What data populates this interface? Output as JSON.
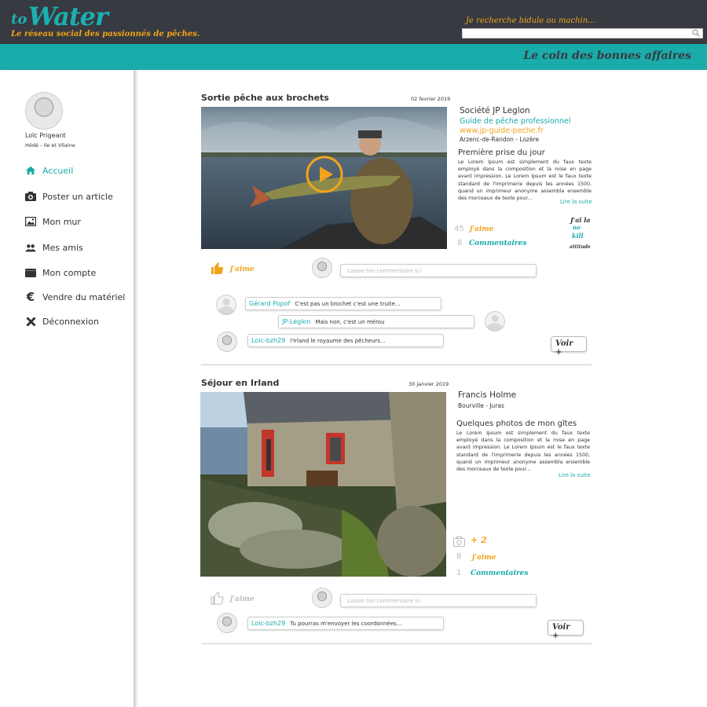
{
  "header": {
    "logo_prefix": "to",
    "logo_main": "Water",
    "tagline": "Le réseau social des passionnés de pêches.",
    "search_placeholder": "Je recherche bidule ou machin...",
    "deals_link": "Le coin des bonnes affaires"
  },
  "user": {
    "name": "Loïc Prigeant",
    "location": "Hédé - Ile et Vilaine"
  },
  "nav": [
    {
      "label": "Accueil",
      "icon": "home-icon"
    },
    {
      "label": "Poster un article",
      "icon": "camera-icon"
    },
    {
      "label": "Mon mur",
      "icon": "image-icon"
    },
    {
      "label": "Mes amis",
      "icon": "friends-icon"
    },
    {
      "label": "Mon compte",
      "icon": "wallet-icon"
    },
    {
      "label": "Vendre du matériel",
      "icon": "euro-icon"
    },
    {
      "label": "Déconnexion",
      "icon": "close-icon"
    }
  ],
  "posts": [
    {
      "title": "Sortie pêche aux brochets",
      "date": "02 fevrier 2019",
      "author": "Société JP Leglon",
      "subtitle": "Guide de pêche professionnel",
      "website": "www.jp-guide-peche.fr",
      "location": "Arzenc-de-Randon - Lozère",
      "headline": "Première prise du jour",
      "excerpt": "Le Lorem Ipsum est simplement du faux texte employé dans la composition et la mise en page avant impression. Le Lorem Ipsum est le faux texte standard de l'imprimerie depuis les années 1500, quand un imprimeur anonyme assembla ensemble des morceaux de texte pour...",
      "read_more": "Lire la suite",
      "likes": "45",
      "likes_label": "j'aime",
      "comments_count": "8",
      "comments_label": "Commentaires",
      "badge": [
        "J'ai la",
        "no",
        "kill",
        "attitude"
      ],
      "like_label": "j'aime",
      "comment_placeholder": "Laisse ton commentaire ici",
      "comments": [
        {
          "author": "Gérard Popof",
          "text": "C'est pas un brochet c'est une truite..."
        },
        {
          "author": "JP-Leglon",
          "text": "Mais non, c'est un mérou"
        },
        {
          "author": "Loic-bzh29",
          "text": "l'Irland le royaume des pêcheurs..."
        }
      ],
      "more_label": "Voir +"
    },
    {
      "title": "Séjour en Irland",
      "date": "30 janvier 2019",
      "author": "Francis Holme",
      "location": "Bourville - Juras",
      "headline": "Quelques photos de mon gîtes",
      "excerpt": "Le Lorem Ipsum est simplement du faux texte employé dans la composition et la mise en page avant impression. Le Lorem Ipsum est le faux texte standard de l'imprimerie depuis les années 1500, quand un imprimeur anonyme assembla ensemble des morceaux de texte pour...",
      "read_more": "Lire la suite",
      "photos_extra": "+ 2",
      "likes": "8",
      "likes_label": "j'aime",
      "comments_count": "1",
      "comments_label": "Commentaires",
      "like_label": "j'aime",
      "comment_placeholder": "Laisse ton commentaire ici",
      "comments": [
        {
          "author": "Loic-bzh29",
          "text": "Tu pourras m'envoyer les coordonnées..."
        }
      ],
      "more_label": "Voir +"
    }
  ],
  "colors": {
    "header": "#373a40",
    "teal": "#1aabab",
    "orange": "#f2a31b"
  }
}
